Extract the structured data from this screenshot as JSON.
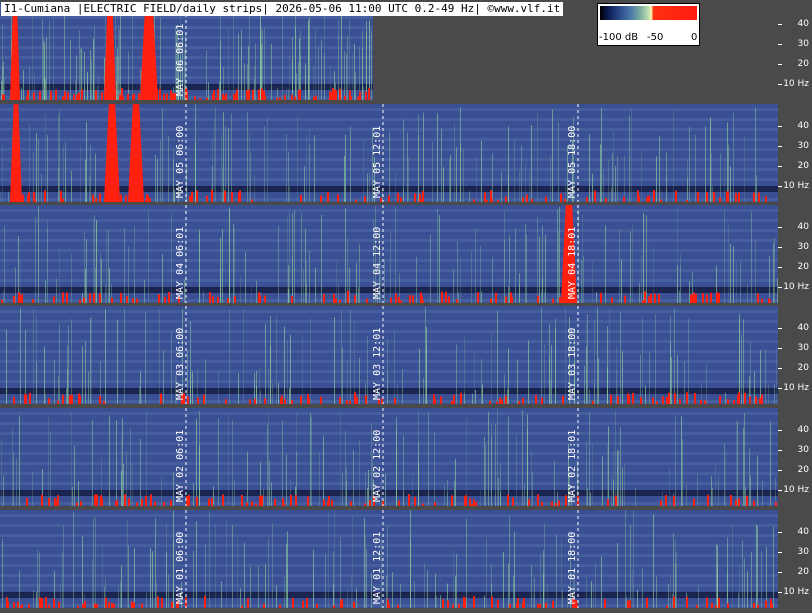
{
  "header": {
    "title": "I1-Cumiana |ELECTRIC FIELD/daily strips| 2026-05-06 11:00 UTC 0.2-49 Hz| ©www.vlf.it"
  },
  "legend": {
    "labels": [
      "-100 dB",
      "-50",
      "0"
    ]
  },
  "axis": {
    "ticks": [
      "40",
      "30",
      "20",
      "10 Hz"
    ]
  },
  "colors": {
    "background_gray": "#4a4a4a",
    "spectrogram_blue": "#3b4f94",
    "noise_green": "#8fcf9f",
    "signal_red": "#ff2010"
  },
  "strips": [
    {
      "day": "MAY 06",
      "labels": [
        "MAY 06 06:01"
      ],
      "progress": 0.48
    },
    {
      "day": "MAY 05",
      "labels": [
        "MAY 05 06:00",
        "MAY 05 12:01",
        "MAY 05 18:00"
      ]
    },
    {
      "day": "MAY 04",
      "labels": [
        "MAY 04 06:01",
        "MAY 04 12:00",
        "MAY 04 18:01"
      ]
    },
    {
      "day": "MAY 03",
      "labels": [
        "MAY 03 06:00",
        "MAY 03 12:01",
        "MAY 03 18:00"
      ]
    },
    {
      "day": "MAY 02",
      "labels": [
        "MAY 02 06:01",
        "MAY 02 12:00",
        "MAY 02 18:01"
      ]
    },
    {
      "day": "MAY 01",
      "labels": [
        "MAY 01 06:00",
        "MAY 01 12:01",
        "MAY 01 18:00"
      ]
    }
  ]
}
